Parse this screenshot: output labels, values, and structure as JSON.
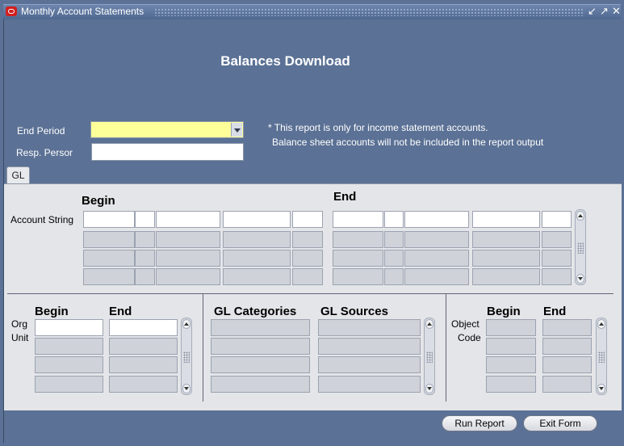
{
  "window": {
    "title": "Monthly Account Statements",
    "controls": [
      "↙",
      "↗",
      "✕"
    ]
  },
  "form": {
    "heading": "Balances Download",
    "end_period_label": "End Period",
    "end_period_value": "",
    "resp_person_label": "Resp. Persor",
    "resp_person_value": "",
    "note_line1": "* This report is only for income statement accounts.",
    "note_line2": "Balance sheet accounts will not be included in the report output"
  },
  "tabs": [
    {
      "label": "GL"
    }
  ],
  "gl": {
    "account_string_label": "Account String",
    "begin_header": "Begin",
    "end_header": "End",
    "org_unit_label_1": "Org",
    "org_unit_label_2": "Unit",
    "org_begin_header": "Begin",
    "org_end_header": "End",
    "gl_categories_header": "GL Categories",
    "gl_sources_header": "GL Sources",
    "object_code_label_1": "Object",
    "object_code_label_2": "Code",
    "object_begin_header": "Begin",
    "object_end_header": "End"
  },
  "buttons": {
    "run_report": "Run Report",
    "exit_form": "Exit Form"
  },
  "colors": {
    "background": "#5b7195",
    "panel": "#e4e5e8",
    "required_field": "#ffff9a"
  }
}
